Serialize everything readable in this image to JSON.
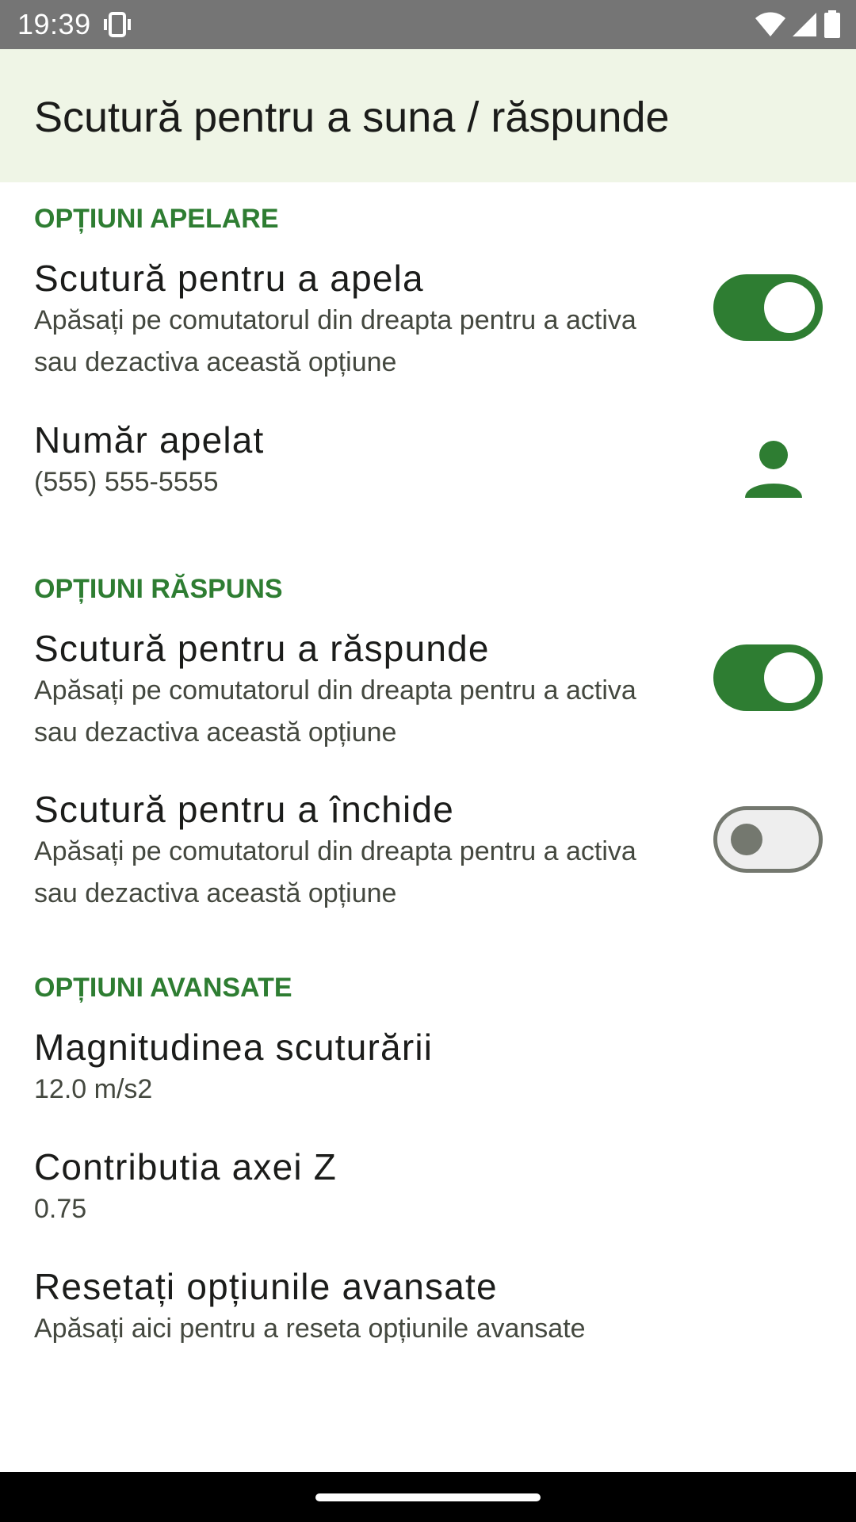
{
  "status_bar": {
    "time": "19:39",
    "icons": [
      "vibrate-icon",
      "wifi-icon",
      "signal-icon",
      "battery-icon"
    ]
  },
  "app_bar": {
    "title": "Scutură pentru a suna / răspunde"
  },
  "colors": {
    "accent": "#2e7d32",
    "app_bar_background": "#eff5e6",
    "status_bar_background": "#757575",
    "switch_off_outline": "#74786f"
  },
  "sections": {
    "call": {
      "header": "OPȚIUNI APELARE",
      "shake_to_call": {
        "title": "Scutură pentru a apela",
        "summary": "Apăsați pe comutatorul din dreapta pentru a activa sau dezactiva această opțiune",
        "enabled": true
      },
      "number": {
        "title": "Număr apelat",
        "value": "(555) 555-5555",
        "icon": "contact-person-icon"
      }
    },
    "answer": {
      "header": "OPȚIUNI RĂSPUNS",
      "shake_to_answer": {
        "title": "Scutură pentru a răspunde",
        "summary": "Apăsați pe comutatorul din dreapta pentru a activa sau dezactiva această opțiune",
        "enabled": true
      },
      "shake_to_hangup": {
        "title": "Scutură pentru a închide",
        "summary": "Apăsați pe comutatorul din dreapta pentru a activa sau dezactiva această opțiune",
        "enabled": false
      }
    },
    "advanced": {
      "header": "OPȚIUNI AVANSATE",
      "magnitude": {
        "title": "Magnitudinea scuturării",
        "value": "12.0 m/s2"
      },
      "z_axis": {
        "title": "Contributia axei Z",
        "value": "0.75"
      },
      "reset": {
        "title": "Resetați opțiunile avansate",
        "summary": "Apăsați aici pentru a reseta opțiunile avansate"
      }
    }
  }
}
